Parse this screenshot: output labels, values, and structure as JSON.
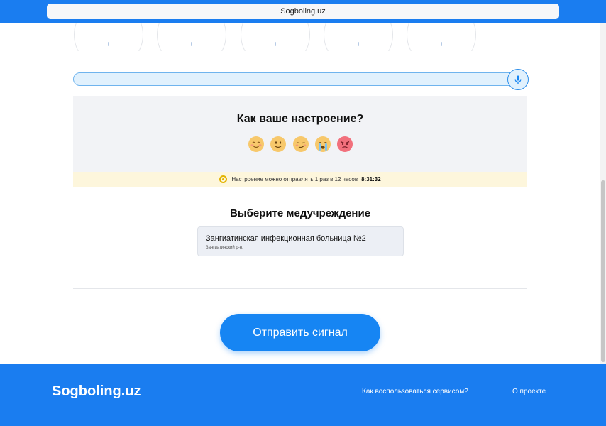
{
  "browser": {
    "url": "Sogboling.uz"
  },
  "mood": {
    "title": "Как ваше настроение?",
    "emojis": [
      {
        "icon": "smiling-blush-emoji-icon",
        "color": "#f7c86b"
      },
      {
        "icon": "slight-smile-emoji-icon",
        "color": "#f7c86b"
      },
      {
        "icon": "smirk-emoji-icon",
        "color": "#f7c86b"
      },
      {
        "icon": "crying-emoji-icon",
        "color": "#f7c86b"
      },
      {
        "icon": "angry-emoji-icon",
        "color": "#f2707c"
      }
    ],
    "notice": "Настроение можно отправлять 1 раз в 12 часов",
    "timer": "8:31:32"
  },
  "institution": {
    "heading": "Выберите медучреждение",
    "name": "Зангиатинская инфекционная больница №2",
    "district": "Зангиатинский р-н."
  },
  "send_label": "Отправить сигнал",
  "footer": {
    "logo": "Sogboling.uz",
    "links": [
      "Как воспользоваться сервисом?",
      "О проекте"
    ]
  },
  "colors": {
    "accent": "#1685f3",
    "header": "#1a7df0"
  }
}
